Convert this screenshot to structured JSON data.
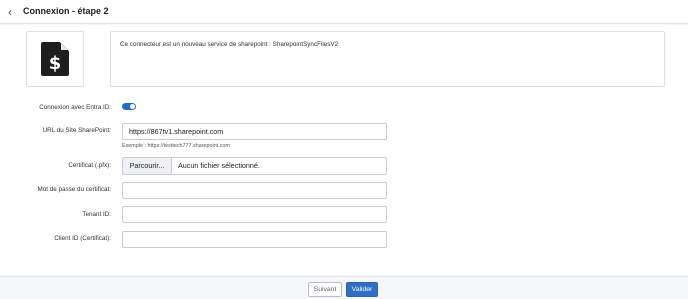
{
  "header": {
    "back_icon": "chevron-left-icon",
    "title": "Connexion - étape 2"
  },
  "connector": {
    "icon": "document-dollar-icon",
    "description": "Ce connecteur est un nouveau service de sharepoint : SharepointSyncFilesV2"
  },
  "form": {
    "entra": {
      "label": "Connexion avec Entra ID:",
      "enabled": true
    },
    "site_url": {
      "label": "URL du Site SharePoint:",
      "value": "https://867tv1.sharepoint.com",
      "hint": "Exemple : https://testtech777.sharepoint.com"
    },
    "certificate": {
      "label": "Certificat (.pfx):",
      "browse_label": "Parcourir...",
      "no_file": "Aucun fichier sélectionné."
    },
    "cert_password": {
      "label": "Mot de passe du certificat:",
      "value": ""
    },
    "tenant_id": {
      "label": "Tenant ID:",
      "value": ""
    },
    "client_id": {
      "label": "Client ID (Certificat):",
      "value": ""
    }
  },
  "footer": {
    "next_label": "Suivant",
    "validate_label": "Valider"
  },
  "colors": {
    "accent": "#2f6fc6",
    "toggle_on": "#1f6fd1"
  }
}
